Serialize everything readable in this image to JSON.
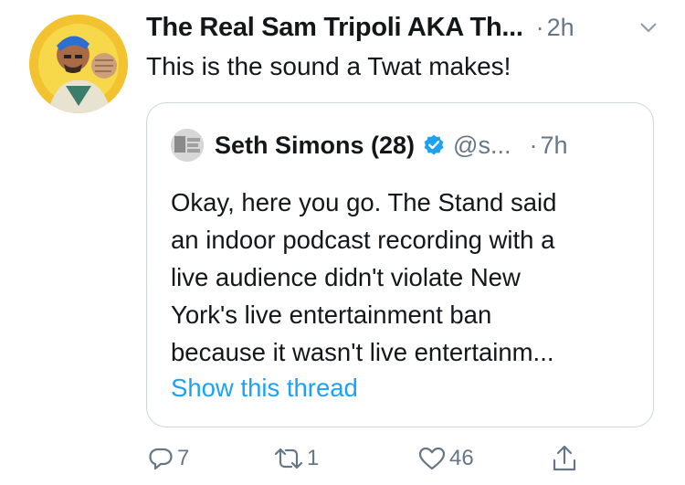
{
  "tweet": {
    "author_name": "The Real Sam Tripoli AKA Th...",
    "separator": "·",
    "timestamp": "2h",
    "text": "This is the sound a Twat makes!"
  },
  "quoted_tweet": {
    "author_name": "Seth Simons (28)",
    "handle": "@s...",
    "separator": "·",
    "timestamp": "7h",
    "text_lines": [
      "Okay, here you go. The Stand said",
      "an indoor podcast recording with a",
      "live audience didn't violate New",
      "York's live entertainment ban",
      "because it wasn't live entertainm..."
    ],
    "show_thread_label": "Show this thread"
  },
  "actions": {
    "reply_count": "7",
    "retweet_count": "1",
    "like_count": "46"
  },
  "colors": {
    "link_blue": "#1da1f2",
    "muted_gray": "#657786",
    "border": "#ccd6dd",
    "verified_blue": "#1da1f2",
    "avatar_bg": "#f2c230"
  },
  "icons": {
    "reply": "reply-icon",
    "retweet": "retweet-icon",
    "like": "heart-icon",
    "share": "share-icon",
    "menu": "chevron-down-icon",
    "verified": "verified-badge-icon"
  }
}
